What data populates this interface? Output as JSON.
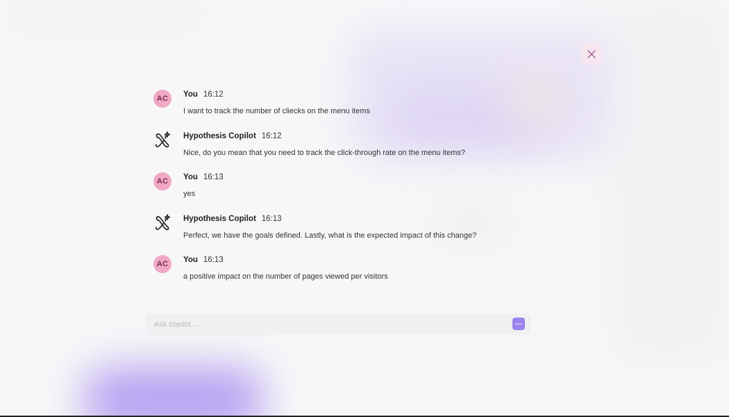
{
  "close_label": "Close",
  "colors": {
    "accent": "#9c82ee",
    "avatar_bg": "#f0a8c4",
    "close_bg": "#f6e6f0"
  },
  "messages": [
    {
      "type": "user",
      "avatar": "AC",
      "author": "You",
      "time": "16:12",
      "text": "I want to track the number of cliecks on the menu items"
    },
    {
      "type": "bot",
      "icon": "copilot-sparkle-icon",
      "author": "Hypothesis Copilot",
      "time": "16:12",
      "text": "Nice, do you mean that you need to track the click-through rate on the menu items?"
    },
    {
      "type": "user",
      "avatar": "AC",
      "author": "You",
      "time": "16:13",
      "text": "yes"
    },
    {
      "type": "bot",
      "icon": "copilot-sparkle-icon",
      "author": "Hypothesis Copilot",
      "time": "16:13",
      "text": "Perfect, we have the goals defined. Lastly, what is the expected impact of this change?"
    },
    {
      "type": "user",
      "avatar": "AC",
      "author": "You",
      "time": "16:13",
      "text": "a positive impact on the number of pages viewed per visitors"
    }
  ],
  "input": {
    "placeholder": "Ask copilot ...",
    "value": ""
  },
  "send_icon": "ellipsis-icon"
}
